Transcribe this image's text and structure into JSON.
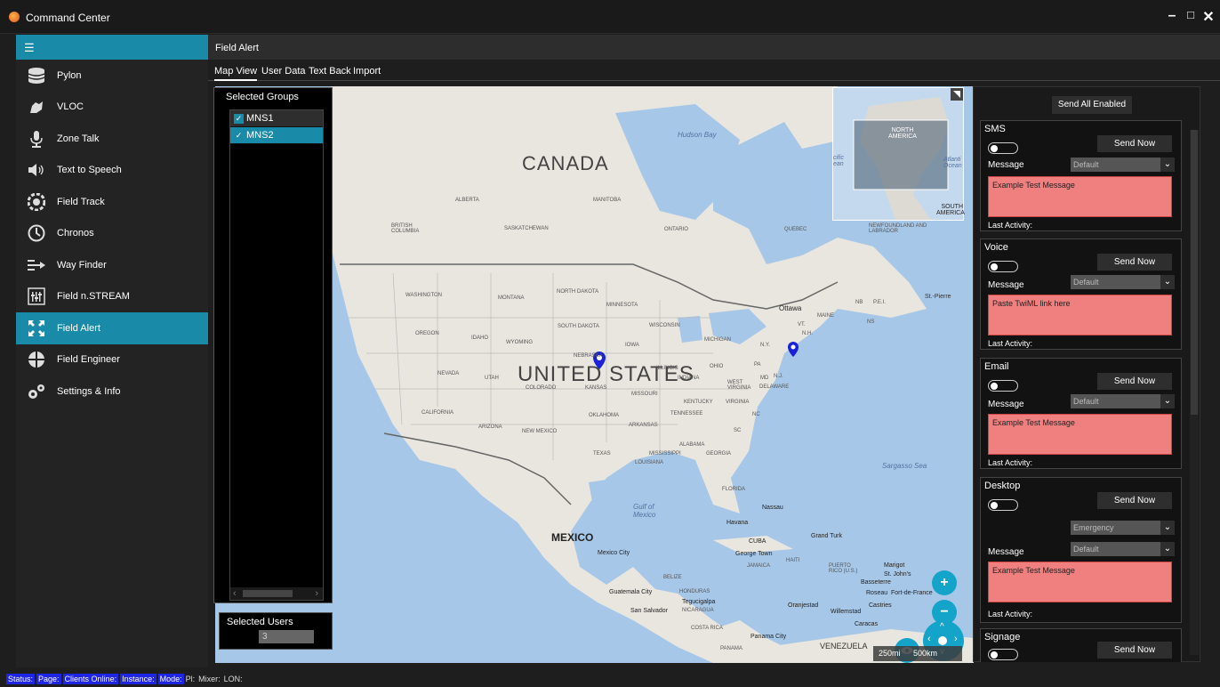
{
  "window": {
    "title": "Command Center",
    "minimize": "–",
    "maximize": "□",
    "close": "✕"
  },
  "sidebar": {
    "menu_icon": "☰",
    "items": [
      {
        "label": "Pylon",
        "icon": "database-icon"
      },
      {
        "label": "VLOC",
        "icon": "vloc-icon"
      },
      {
        "label": "Zone Talk",
        "icon": "microphone-icon"
      },
      {
        "label": "Text to Speech",
        "icon": "speaker-icon"
      },
      {
        "label": "Field Track",
        "icon": "field-track-icon"
      },
      {
        "label": "Chronos",
        "icon": "clock-icon"
      },
      {
        "label": "Way Finder",
        "icon": "way-finder-icon"
      },
      {
        "label": "Field n.STREAM",
        "icon": "equalizer-icon"
      },
      {
        "label": "Field Alert",
        "icon": "expand-arrows-icon",
        "active": true
      },
      {
        "label": "Field Engineer",
        "icon": "field-engineer-icon"
      },
      {
        "label": "Settings & Info",
        "icon": "gears-icon"
      }
    ]
  },
  "page": {
    "title": "Field Alert",
    "tabs": [
      "Map View",
      "User Data",
      "Text Back",
      "Import"
    ]
  },
  "groups": {
    "title": "Selected Groups",
    "items": [
      {
        "label": "MNS1",
        "checked": true
      },
      {
        "label": "MNS2",
        "checked": true
      }
    ],
    "scroll_left": "‹",
    "scroll_right": "›"
  },
  "users": {
    "title": "Selected Users",
    "count": "3"
  },
  "map": {
    "labels": {
      "canada": "CANADA",
      "us": "UNITED STATES",
      "mexico": "MEXICO",
      "hudson": "Hudson Bay",
      "gulf": "Gulf of Mexico",
      "sargasso": "Sargasso Sea",
      "alberta": "ALBERTA",
      "manitoba": "MANITOBA",
      "saskatchewan": "SASKATCHEWAN",
      "ontario": "ONTARIO",
      "quebec": "QUEBEC",
      "bc": "BRITISH COLUMBIA",
      "nl": "NEWFOUNDLAND AND LABRADOR",
      "washington": "WASHINGTON",
      "montana": "MONTANA",
      "north_dakota": "NORTH DAKOTA",
      "minnesota": "MINNESOTA",
      "oregon": "OREGON",
      "idaho": "IDAHO",
      "wyoming": "WYOMING",
      "south_dakota": "SOUTH DAKOTA",
      "wisconsin": "WISCONSIN",
      "michigan": "MICHIGAN",
      "iowa": "IOWA",
      "nebraska": "NEBRASKA",
      "nevada": "NEVADA",
      "utah": "UTAH",
      "colorado": "COLORADO",
      "kansas": "KANSAS",
      "missouri": "MISSOURI",
      "illinois": "ILLINOIS",
      "indiana": "INDIANA",
      "ohio": "OHIO",
      "pa": "PA",
      "ny": "N.Y.",
      "california": "CALIFORNIA",
      "oklahoma": "OKLAHOMA",
      "tennessee": "TENNESSEE",
      "kentucky": "KENTUCKY",
      "virginia": "VIRGINIA",
      "west_virginia": "WEST VIRGINIA",
      "arizona": "ARIZONA",
      "new_mexico": "NEW MEXICO",
      "arkansas": "ARKANSAS",
      "texas": "TEXAS",
      "louisiana": "LOUISIANA",
      "mississippi": "MISSISSIPPI",
      "alabama": "ALABAMA",
      "georgia": "GEORGIA",
      "florida": "FLORIDA",
      "nc": "NC",
      "sc": "SC",
      "ottawa": "Ottawa",
      "maine": "MAINE",
      "vt": "VT.",
      "nh": "N.H.",
      "nb": "NB",
      "pei": "P.E.I.",
      "ns": "NS",
      "st_pierre": "St.-Pierre",
      "md": "MD",
      "nj": "N.J.",
      "delaware": "DELAWARE",
      "mexico_city": "Mexico City",
      "havana": "Havana",
      "nassau": "Nassau",
      "cuba": "CUBA",
      "jamaica": "JAMAICA",
      "haiti": "HAITI",
      "george_town": "George Town",
      "grand_turk": "Grand Turk",
      "puerto_rico": "PUERTO RICO (U.S.)",
      "belize": "BELIZE",
      "guatemala": "Guatemala City",
      "honduras": "HONDURAS",
      "tegucigalpa": "Tegucigalpa",
      "san_salvador": "San Salvador",
      "nicaragua": "NICARAGUA",
      "costa_rica": "COSTA RICA",
      "panama_city": "Panama City",
      "panama": "PANAMA",
      "venezuela": "VENEZUELA",
      "oranjestad": "Oranjestad",
      "willemstad": "Willemstad",
      "caracas": "Caracas",
      "castries": "Castries",
      "st_johns": "St. John's",
      "basseterre": "Basseterre",
      "marigot": "Marigot",
      "roseau": "Roseau",
      "fort_de_france": "Fort-de-France",
      "minimap_na": "NORTH AMERICA",
      "minimap_sa": "SOUTH AMERICA",
      "minimap_pacific": "cific ean",
      "minimap_atlantic": "Atlanti Ocean"
    },
    "scale": {
      "mi": "250mi",
      "km": "500km"
    },
    "zoom_in": "+",
    "zoom_out": "−"
  },
  "right_panel": {
    "send_all": "Send All Enabled",
    "cards": [
      {
        "title": "SMS",
        "send": "Send Now",
        "message_label": "Message",
        "dropdown": "Default",
        "message": "Example Test Message",
        "last_activity": "Last Activity:"
      },
      {
        "title": "Voice",
        "send": "Send Now",
        "message_label": "Message",
        "dropdown": "Default",
        "message": "Paste TwiML link here",
        "last_activity": "Last Activity:"
      },
      {
        "title": "Email",
        "send": "Send Now",
        "message_label": "Message",
        "dropdown": "Default",
        "message": "Example Test Message",
        "last_activity": "Last Activity:"
      },
      {
        "title": "Desktop",
        "send": "Send Now",
        "message_label": "Message",
        "dropdown_priority": "Emergency",
        "dropdown": "Default",
        "message": "Example Test Message",
        "last_activity": "Last Activity:"
      },
      {
        "title": "Signage",
        "send": "Send Now"
      }
    ]
  },
  "statusbar": {
    "items": [
      "Status:",
      "Page:",
      "Clients Online:",
      "Instance:",
      "Mode:"
    ],
    "plain": [
      "Pl:",
      "Mixer:",
      "LON:"
    ]
  }
}
